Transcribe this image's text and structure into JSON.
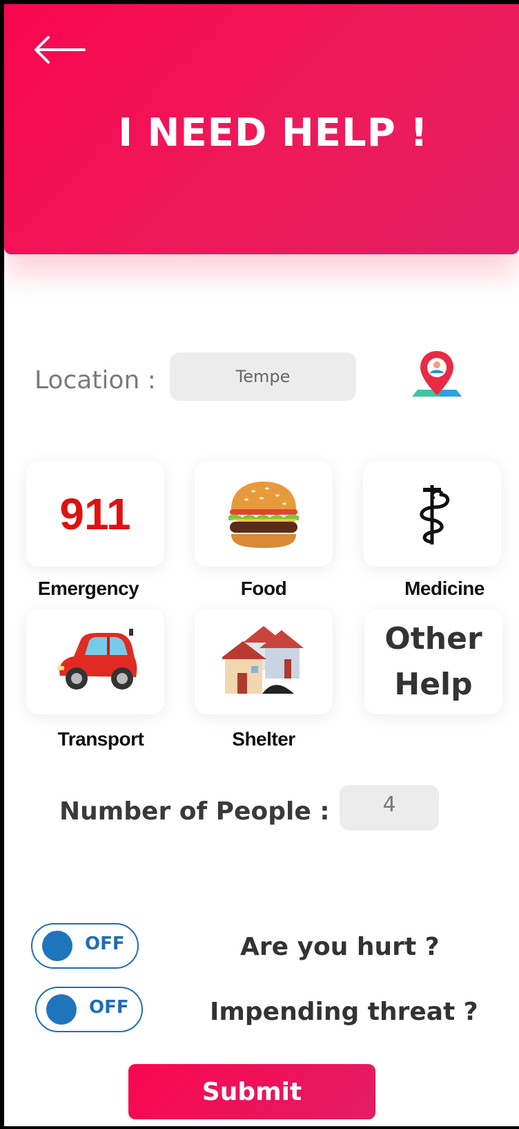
{
  "header": {
    "title": "I NEED HELP !",
    "back_icon": "arrow-left-icon"
  },
  "location": {
    "label": "Location :",
    "value": "Tempe",
    "pin_icon": "map-pin-icon"
  },
  "categories": [
    {
      "label": "Emergency",
      "icon": "911",
      "icon_name": "emergency-911-icon"
    },
    {
      "label": "Food",
      "icon": "burger",
      "icon_name": "burger-icon"
    },
    {
      "label": "Medicine",
      "icon": "caduceus",
      "icon_name": "medical-staff-icon"
    },
    {
      "label": "Transport",
      "icon": "car",
      "icon_name": "car-icon"
    },
    {
      "label": "Shelter",
      "icon": "houses",
      "icon_name": "houses-icon"
    },
    {
      "label": "",
      "tile_text_1": "Other",
      "tile_text_2": "Help"
    }
  ],
  "people": {
    "label": "Number of People :",
    "value": "4"
  },
  "toggles": [
    {
      "state": "OFF",
      "question": "Are you hurt ?"
    },
    {
      "state": "OFF",
      "question": "Impending threat ?"
    }
  ],
  "submit_label": "Submit",
  "colors": {
    "accent": "#f90650",
    "toggle": "#1f6db5"
  }
}
